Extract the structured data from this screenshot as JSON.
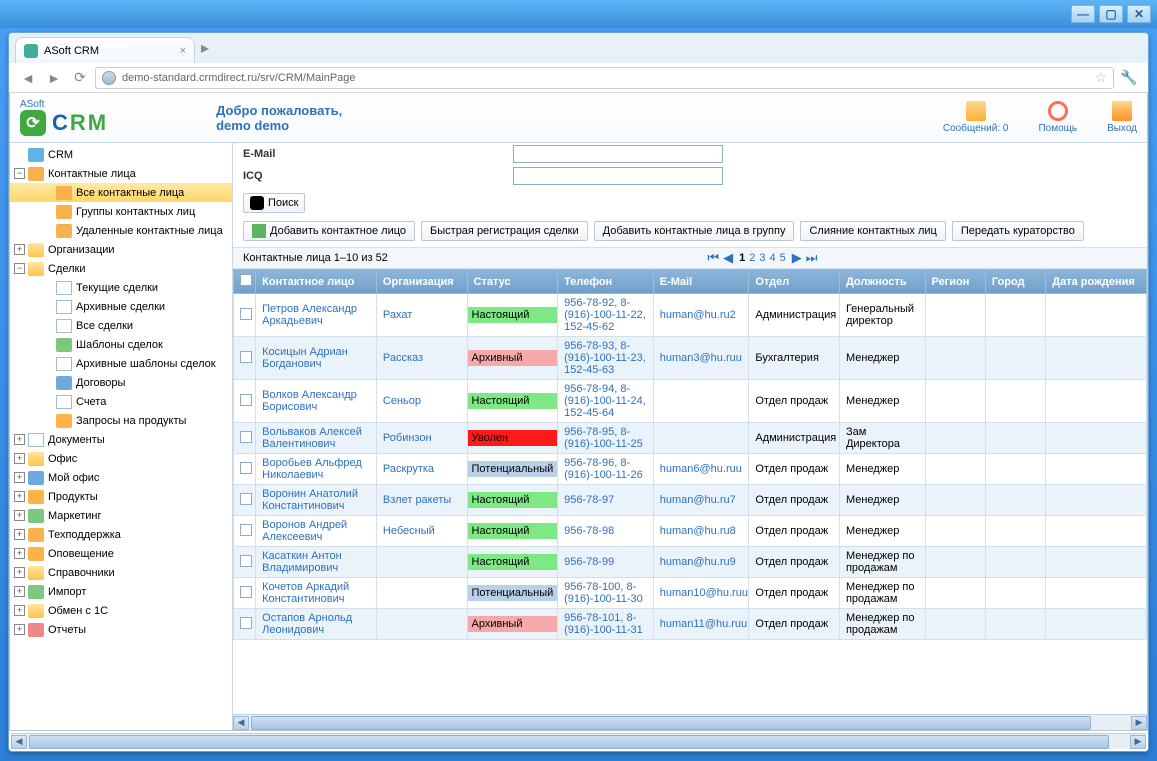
{
  "window": {
    "tab_title": "ASoft CRM",
    "url": "demo-standard.crmdirect.ru/srv/CRM/MainPage"
  },
  "header": {
    "brand_small": "ASoft",
    "brand_c": "C",
    "brand_r": "R",
    "brand_m": "M",
    "welcome_line1": "Добро пожаловать,",
    "welcome_line2": "demo demo",
    "messages": "Сообщений: 0",
    "help": "Помощь",
    "exit": "Выход"
  },
  "sidebar": {
    "root": "CRM",
    "contacts": "Контактные лица",
    "contacts_children": [
      "Все контактные лица",
      "Группы контактных лиц",
      "Удаленные контактные лица"
    ],
    "orgs": "Организации",
    "deals": "Сделки",
    "deals_children": [
      "Текущие сделки",
      "Архивные сделки",
      "Все сделки",
      "Шаблоны сделок",
      "Архивные шаблоны сделок",
      "Договоры",
      "Счета",
      "Запросы на продукты"
    ],
    "rest": [
      "Документы",
      "Офис",
      "Мой офис",
      "Продукты",
      "Маркетинг",
      "Техподдержка",
      "Оповещение",
      "Справочники",
      "Импорт",
      "Обмен с 1С",
      "Отчеты"
    ]
  },
  "form": {
    "email_label": "E-Mail",
    "icq_label": "ICQ"
  },
  "search_label": "Поиск",
  "buttons": [
    "Добавить контактное лицо",
    "Быстрая регистрация сделки",
    "Добавить контактные лица в группу",
    "Слияние контактных лиц",
    "Передать кураторство"
  ],
  "table_caption": "Контактные лица 1–10 из 52",
  "pager_pages": [
    "1",
    "2",
    "3",
    "4",
    "5"
  ],
  "columns": [
    "Контактное лицо",
    "Организация",
    "Статус",
    "Телефон",
    "E-Mail",
    "Отдел",
    "Должность",
    "Регион",
    "Город",
    "Дата рождения"
  ],
  "rows": [
    {
      "name": "Петров Александр Аркадьевич",
      "org": "Рахат",
      "status": "Настоящий",
      "stclass": "st-green",
      "phone": "956-78-92, 8-(916)-100-11-22, 152-45-62",
      "email": "human@hu.ru2",
      "dept": "Администрация",
      "pos": "Генеральный директор"
    },
    {
      "name": "Косицын Адриан Богданович",
      "org": "Рассказ",
      "status": "Архивный",
      "stclass": "st-pink",
      "phone": "956-78-93, 8-(916)-100-11-23, 152-45-63",
      "email": "human3@hu.ruu",
      "dept": "Бухгалтерия",
      "pos": "Менеджер"
    },
    {
      "name": "Волков Александр Борисович",
      "org": "Сеньор",
      "status": "Настоящий",
      "stclass": "st-green",
      "phone": "956-78-94, 8-(916)-100-11-24, 152-45-64",
      "email": "",
      "dept": "Отдел продаж",
      "pos": "Менеджер"
    },
    {
      "name": "Вольваков Алексей Валентинович",
      "org": "Робинзон",
      "status": "Уволен",
      "stclass": "st-red",
      "phone": "956-78-95, 8-(916)-100-11-25",
      "email": "",
      "dept": "Администрация",
      "pos": "Зам Директора"
    },
    {
      "name": "Воробьев Альфред Николаевич",
      "org": "Раскрутка",
      "status": "Потенциальный",
      "stclass": "st-blue",
      "phone": "956-78-96, 8-(916)-100-11-26",
      "email": "human6@hu.ruu",
      "dept": "Отдел продаж",
      "pos": "Менеджер"
    },
    {
      "name": "Воронин Анатолий Константинович",
      "org": "Взлет ракеты",
      "status": "Настоящий",
      "stclass": "st-green",
      "phone": "956-78-97",
      "email": "human@hu.ru7",
      "dept": "Отдел продаж",
      "pos": "Менеджер"
    },
    {
      "name": "Воронов Андрей Алексеевич",
      "org": "Небесный",
      "status": "Настоящий",
      "stclass": "st-green",
      "phone": "956-78-98",
      "email": "human@hu.ru8",
      "dept": "Отдел продаж",
      "pos": "Менеджер"
    },
    {
      "name": "Касаткин Антон Владимирович",
      "org": "",
      "status": "Настоящий",
      "stclass": "st-green",
      "phone": "956-78-99",
      "email": "human@hu.ru9",
      "dept": "Отдел продаж",
      "pos": "Менеджер по продажам"
    },
    {
      "name": "Кочетов Аркадий Константинович",
      "org": "",
      "status": "Потенциальный",
      "stclass": "st-blue",
      "phone": "956-78-100, 8-(916)-100-11-30",
      "email": "human10@hu.ruu",
      "dept": "Отдел продаж",
      "pos": "Менеджер по продажам"
    },
    {
      "name": "Остапов Арнольд Леонидович",
      "org": "",
      "status": "Архивный",
      "stclass": "st-pink",
      "phone": "956-78-101, 8-(916)-100-11-31",
      "email": "human11@hu.ruu",
      "dept": "Отдел продаж",
      "pos": "Менеджер по продажам"
    }
  ]
}
